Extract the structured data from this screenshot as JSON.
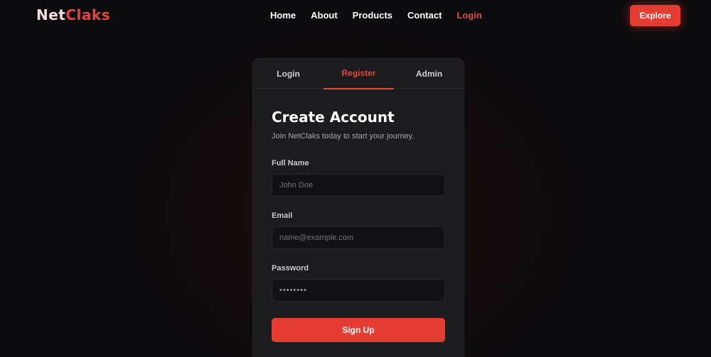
{
  "nav": {
    "brand_part1": "Net",
    "brand_part2": "Claks",
    "links": [
      "Home",
      "About",
      "Products",
      "Contact",
      "Login"
    ],
    "active_link": "Login",
    "cta_label": "Explore"
  },
  "card": {
    "tabs": [
      "Login",
      "Register",
      "Admin"
    ],
    "active_tab": "Register",
    "title": "Create Account",
    "subtitle": "Join NetClaks today to start your journey.",
    "fields": {
      "name": {
        "label": "Full Name",
        "placeholder": "John Doe"
      },
      "email": {
        "label": "Email",
        "placeholder": "name@example.com"
      },
      "password": {
        "label": "Password",
        "value": "••••••••"
      }
    },
    "submit_label": "Sign Up"
  },
  "colors": {
    "accent": "#e53d32",
    "background": "#0c0b0d",
    "card": "#1c1b1e"
  }
}
